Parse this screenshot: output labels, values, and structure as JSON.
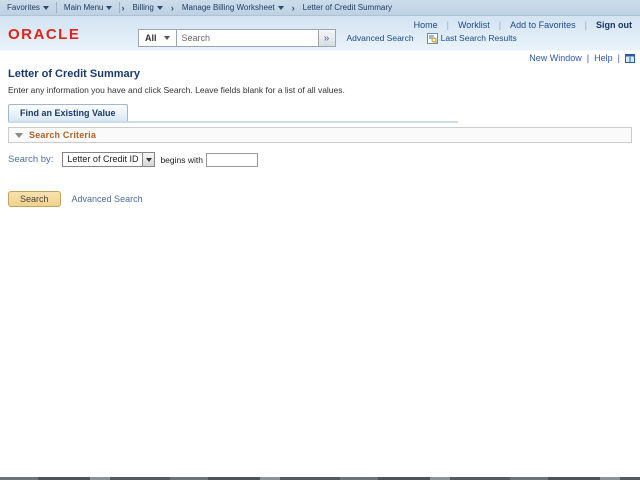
{
  "topbar": {
    "items": [
      {
        "label": "Favorites"
      },
      {
        "label": "Main Menu"
      },
      {
        "label": "Billing"
      },
      {
        "label": "Manage Billing Worksheet"
      },
      {
        "label": "Letter of Credit Summary"
      }
    ]
  },
  "header": {
    "logo": "ORACLE",
    "links": {
      "home": "Home",
      "worklist": "Worklist",
      "add_to_favorites": "Add to Favorites",
      "sign_out": "Sign out"
    },
    "search": {
      "scope": "All",
      "placeholder": "Search",
      "advanced_label": "Advanced Search",
      "last_results_label": "Last Search Results"
    }
  },
  "page_links": {
    "new_window": "New Window",
    "help": "Help"
  },
  "main": {
    "title": "Letter of Credit Summary",
    "instruction": "Enter any information you have and click Search. Leave fields blank for a list of all values.",
    "tab_label": "Find an Existing Value",
    "criteria_header": "Search Criteria",
    "search_by_label": "Search by:",
    "search_field_selected": "Letter of Credit ID",
    "operator": "begins with",
    "keyword_value": "",
    "search_button": "Search",
    "advanced_search": "Advanced Search"
  },
  "colors": {
    "oracle_red": "#e0231c",
    "header_blue": "#d3e3f1",
    "navy_link": "#1d4a86",
    "title_navy": "#1b3a6b",
    "criteria_orange": "#b05f23",
    "steel_blue_label": "#51709c",
    "search_button_tan": "#f5d79a"
  }
}
